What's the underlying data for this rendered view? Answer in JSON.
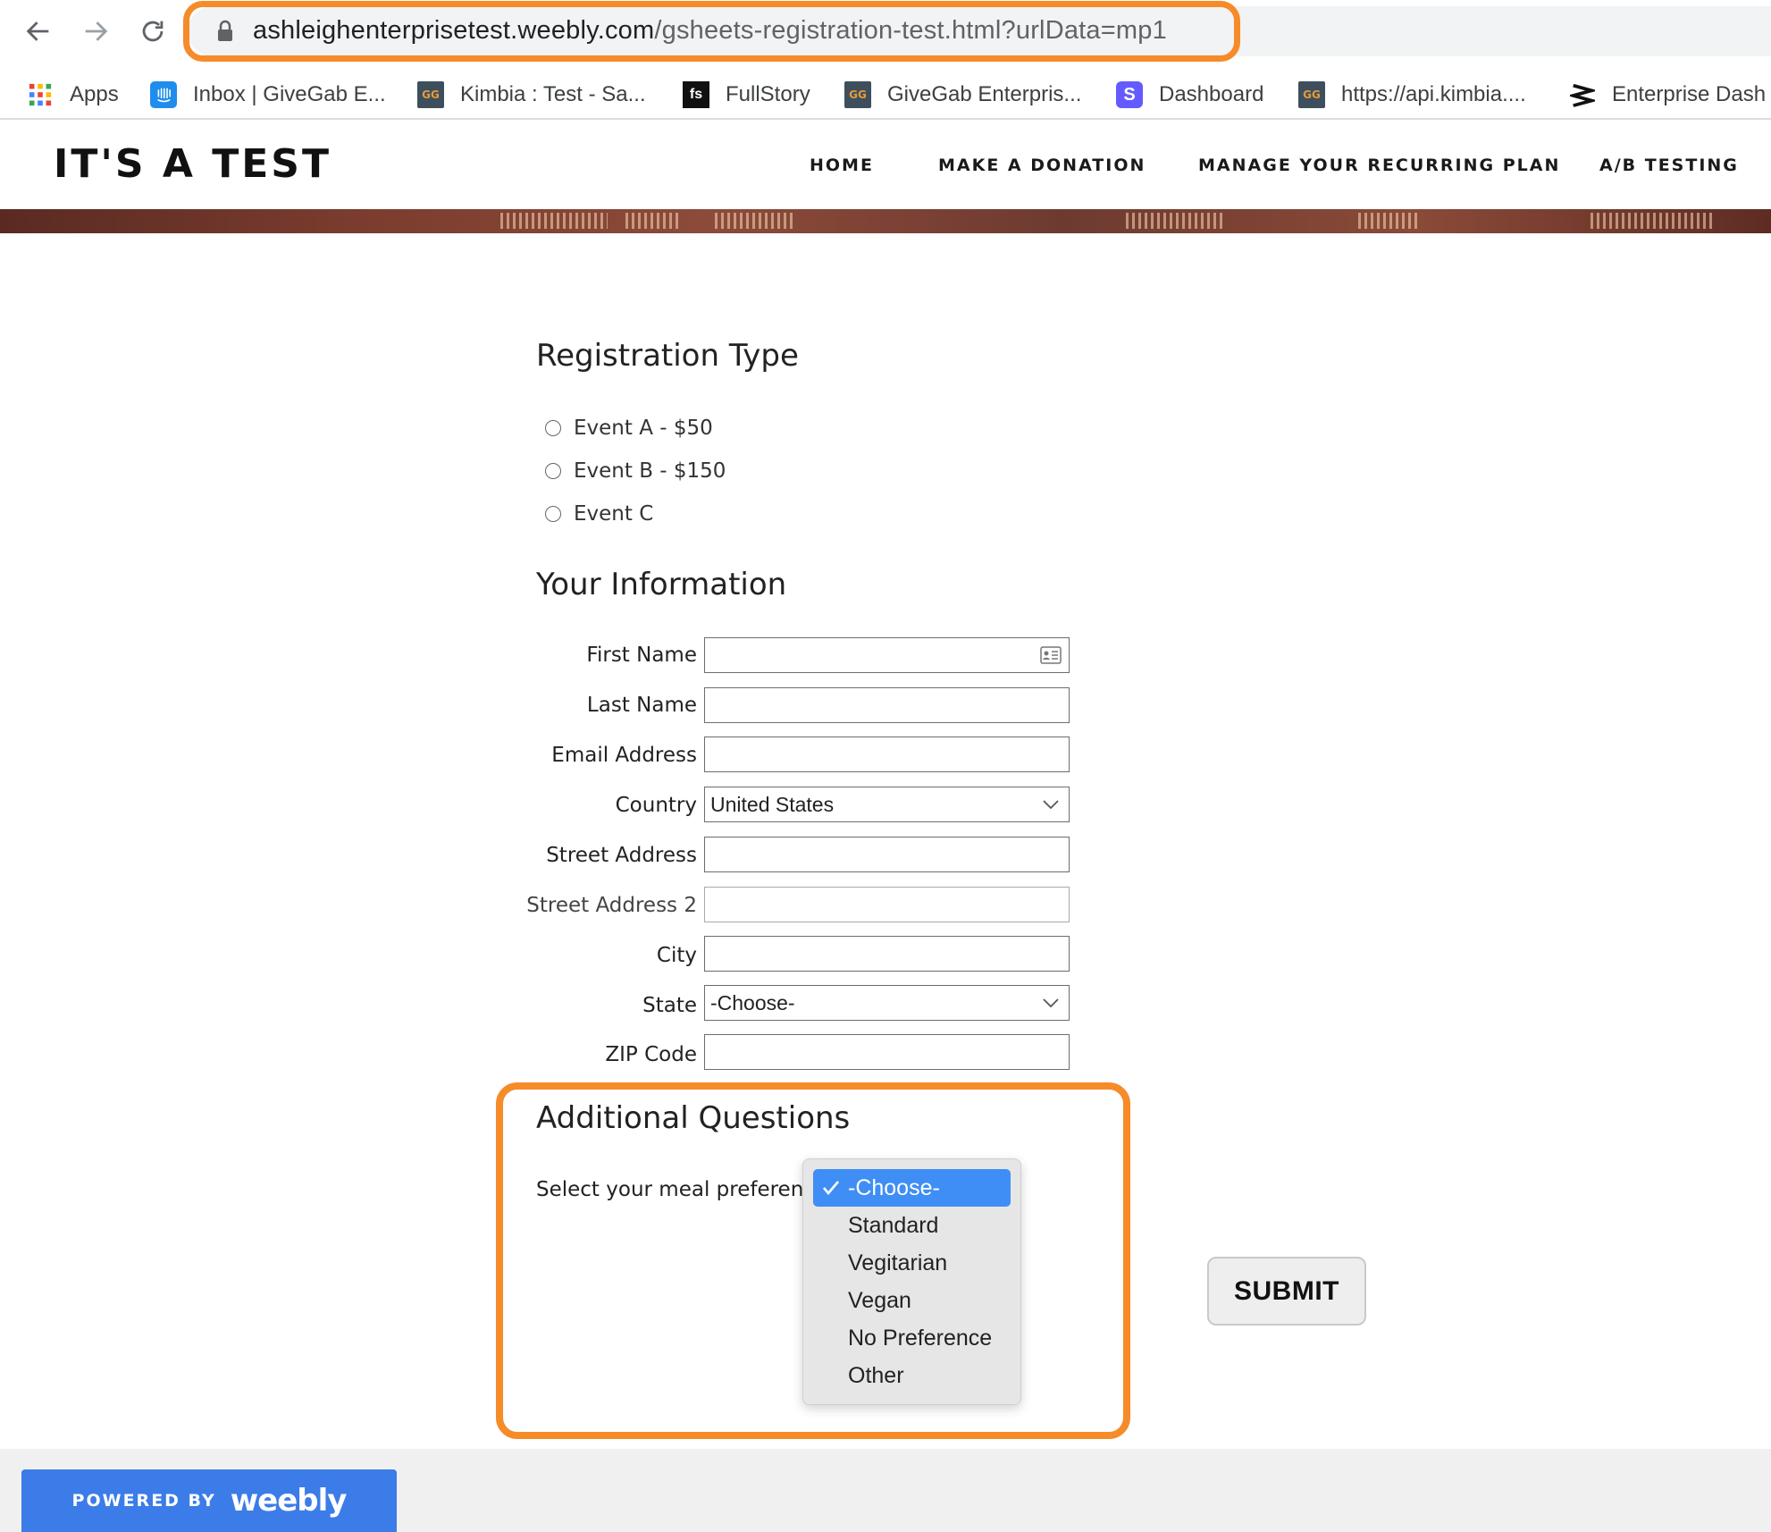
{
  "browser": {
    "url_host": "ashleighenterprisetest.weebly.com",
    "url_path": "/gsheets-registration-test.html?urlData=mp1",
    "bookmarks": [
      {
        "label": "Apps",
        "icon": "apps-grid-icon"
      },
      {
        "label": "Inbox | GiveGab E...",
        "icon": "intercom-icon"
      },
      {
        "label": "Kimbia : Test - Sa...",
        "icon": "givegab-icon"
      },
      {
        "label": "FullStory",
        "icon": "fullstory-icon"
      },
      {
        "label": "GiveGab Enterpris...",
        "icon": "givegab-icon"
      },
      {
        "label": "Dashboard",
        "icon": "stripe-icon"
      },
      {
        "label": "https://api.kimbia....",
        "icon": "givegab-icon"
      },
      {
        "label": "Enterprise Dash",
        "icon": "enterprise-icon"
      }
    ]
  },
  "site": {
    "title": "IT'S A TEST",
    "menu": [
      "HOME",
      "MAKE A DONATION",
      "MANAGE YOUR RECURRING PLAN",
      "A/B TESTING"
    ]
  },
  "registration": {
    "heading": "Registration Type",
    "options": [
      "Event A - $50",
      "Event B - $150",
      "Event C"
    ]
  },
  "info": {
    "heading": "Your Information",
    "fields": {
      "first_name": {
        "label": "First Name",
        "value": ""
      },
      "last_name": {
        "label": "Last Name",
        "value": ""
      },
      "email": {
        "label": "Email Address",
        "value": ""
      },
      "country": {
        "label": "Country",
        "value": "United States"
      },
      "street": {
        "label": "Street Address",
        "value": ""
      },
      "street2": {
        "label": "Street Address 2",
        "value": ""
      },
      "city": {
        "label": "City",
        "value": ""
      },
      "state": {
        "label": "State",
        "value": "-Choose-"
      },
      "zip": {
        "label": "ZIP Code",
        "value": ""
      }
    }
  },
  "additional": {
    "heading": "Additional Questions",
    "meal_label": "Select your meal preference",
    "meal_options": [
      "-Choose-",
      "Standard",
      "Vegitarian",
      "Vegan",
      "No Preference",
      "Other"
    ],
    "selected_index": 0
  },
  "submit_label": "SUBMIT",
  "footer": {
    "powered_by": "POWERED BY",
    "brand": "weebly"
  },
  "colors": {
    "highlight": "#f68b2a",
    "selected_option": "#3f8ef5",
    "weebly_blue": "#3b7ce8"
  }
}
